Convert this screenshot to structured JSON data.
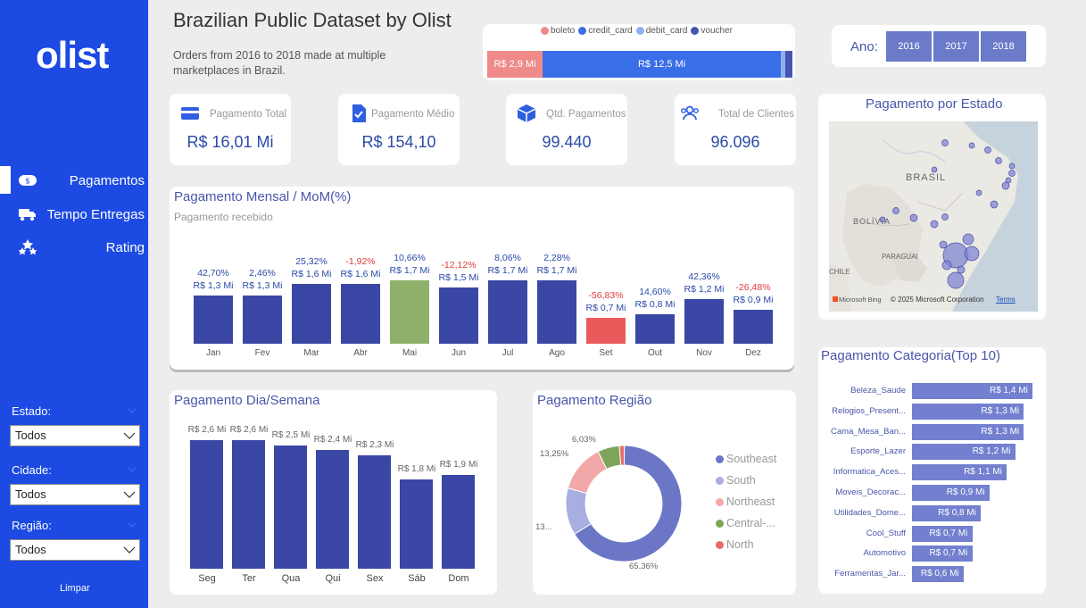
{
  "sidebar": {
    "logo": "olist",
    "nav": [
      {
        "label": "Pagamentos",
        "icon": "money-icon"
      },
      {
        "label": "Tempo Entregas",
        "icon": "truck-icon"
      },
      {
        "label": "Rating",
        "icon": "stars-icon"
      }
    ],
    "filters": [
      {
        "label": "Estado:",
        "value": "Todos"
      },
      {
        "label": "Cidade:",
        "value": "Todos"
      },
      {
        "label": "Região:",
        "value": "Todos"
      }
    ],
    "clear_label": "Limpar"
  },
  "header": {
    "title": "Brazilian Public Dataset by Olist",
    "subtitle": "Orders from 2016 to 2018 made at multiple marketplaces in Brazil."
  },
  "payment_types": {
    "legend": [
      {
        "name": "boleto",
        "color": "#f08a8a"
      },
      {
        "name": "credit_card",
        "color": "#3a6ee8"
      },
      {
        "name": "debit_card",
        "color": "#8fb0f0"
      },
      {
        "name": "voucher",
        "color": "#4655b0"
      }
    ],
    "segments": [
      {
        "name": "boleto",
        "label": "R$ 2,9 Mi",
        "value": 2.9,
        "color": "#f08a8a"
      },
      {
        "name": "credit_card",
        "label": "R$ 12,5 Mi",
        "value": 12.5,
        "color": "#3a6ee8"
      },
      {
        "name": "debit_card",
        "label": "",
        "value": 0.22,
        "color": "#8fb0f0"
      },
      {
        "name": "voucher",
        "label": "",
        "value": 0.38,
        "color": "#4655b0"
      }
    ]
  },
  "year_slicer": {
    "label": "Ano:",
    "years": [
      "2016",
      "2017",
      "2018"
    ]
  },
  "kpis": [
    {
      "label": "Pagamento Total",
      "value": "R$ 16,01 Mi",
      "icon": "credit-card-icon"
    },
    {
      "label": "Pagamento Médio",
      "value": "R$ 154,10",
      "icon": "document-check-icon"
    },
    {
      "label": "Qtd. Pagamentos",
      "value": "99.440",
      "icon": "package-icon"
    },
    {
      "label": "Total de Clientes",
      "value": "96.096",
      "icon": "users-icon"
    }
  ],
  "monthly": {
    "title": "Pagamento Mensal / MoM(%)",
    "subtitle": "Pagamento recebido"
  },
  "weekday": {
    "title": "Pagamento Dia/Semana"
  },
  "region": {
    "title": "Pagamento Região",
    "legend": [
      "Southeast",
      "South",
      "Northeast",
      "Central-...",
      "North"
    ],
    "labels": [
      "6,03%",
      "13,25%",
      "13...",
      "65,36%"
    ]
  },
  "map": {
    "title": "Pagamento por Estado",
    "labels": {
      "brasil": "BRASIL",
      "bolivia": "BOLÍVIA",
      "paraguai": "PARAGUAI",
      "chile": "CHILE"
    },
    "attribution": "© 2025 Microsoft Corporation",
    "terms": "Terms",
    "bing": "Microsoft Bing"
  },
  "category": {
    "title": "Pagamento Categoria(Top 10)"
  },
  "chart_data": [
    {
      "type": "bar",
      "title": "Pagamento Mensal / MoM(%)",
      "categories": [
        "Jan",
        "Fev",
        "Mar",
        "Abr",
        "Mai",
        "Jun",
        "Jul",
        "Ago",
        "Set",
        "Out",
        "Nov",
        "Dez"
      ],
      "values": [
        1.3,
        1.3,
        1.6,
        1.6,
        1.7,
        1.5,
        1.7,
        1.7,
        0.7,
        0.8,
        1.2,
        0.9
      ],
      "value_labels": [
        "R$ 1,3 Mi",
        "R$ 1,3 Mi",
        "R$ 1,6 Mi",
        "R$ 1,6 Mi",
        "R$ 1,7 Mi",
        "R$ 1,5 Mi",
        "R$ 1,7 Mi",
        "R$ 1,7 Mi",
        "R$ 0,7 Mi",
        "R$ 0,8 Mi",
        "R$ 1,2 Mi",
        "R$ 0,9 Mi"
      ],
      "mom_labels": [
        "42,70%",
        "2,46%",
        "25,32%",
        "-1,92%",
        "10,66%",
        "-12,12%",
        "8,06%",
        "2,28%",
        "-56,83%",
        "14,60%",
        "42,36%",
        "-26,48%"
      ],
      "colors": [
        "#3b47a5",
        "#3b47a5",
        "#3b47a5",
        "#3b47a5",
        "#8fb06a",
        "#3b47a5",
        "#3b47a5",
        "#3b47a5",
        "#ea5a5a",
        "#3b47a5",
        "#3b47a5",
        "#3b47a5"
      ],
      "ylim": [
        0,
        2.5
      ]
    },
    {
      "type": "bar",
      "title": "Pagamento Dia/Semana",
      "categories": [
        "Seg",
        "Ter",
        "Qua",
        "Qui",
        "Sex",
        "Sáb",
        "Dom"
      ],
      "values": [
        2.6,
        2.6,
        2.5,
        2.4,
        2.3,
        1.8,
        1.9
      ],
      "value_labels": [
        "R$ 2,6 Mi",
        "R$ 2,6 Mi",
        "R$ 2,5 Mi",
        "R$ 2,4 Mi",
        "R$ 2,3 Mi",
        "R$ 1,8 Mi",
        "R$ 1,9 Mi"
      ],
      "ylim": [
        0,
        2.6
      ]
    },
    {
      "type": "pie",
      "title": "Pagamento Região",
      "categories": [
        "Southeast",
        "South",
        "Northeast",
        "Central-West",
        "North"
      ],
      "values": [
        65.36,
        13.0,
        13.25,
        6.03,
        1.36
      ],
      "colors": [
        "#6b76c6",
        "#a7aee0",
        "#f2a8a8",
        "#7ea55a",
        "#ea6a6a"
      ]
    },
    {
      "type": "bar",
      "orientation": "horizontal",
      "title": "Pagamento Categoria(Top 10)",
      "categories": [
        "Beleza_Saude",
        "Relogios_Present...",
        "Cama_Mesa_Ban...",
        "Esporte_Lazer",
        "Informatica_Aces...",
        "Moveis_Decorac...",
        "Utilidades_Dome...",
        "Cool_Stuff",
        "Automotivo",
        "Ferramentas_Jar..."
      ],
      "values": [
        1.4,
        1.3,
        1.3,
        1.2,
        1.1,
        0.9,
        0.8,
        0.7,
        0.7,
        0.6
      ],
      "value_labels": [
        "R$ 1,4 Mi",
        "R$ 1,3 Mi",
        "R$ 1,3 Mi",
        "R$ 1,2 Mi",
        "R$ 1,1 Mi",
        "R$ 0,9 Mi",
        "R$ 0,8 Mi",
        "R$ 0,7 Mi",
        "R$ 0,7 Mi",
        "R$ 0,6 Mi"
      ],
      "xlim": [
        0,
        1.4
      ]
    }
  ]
}
